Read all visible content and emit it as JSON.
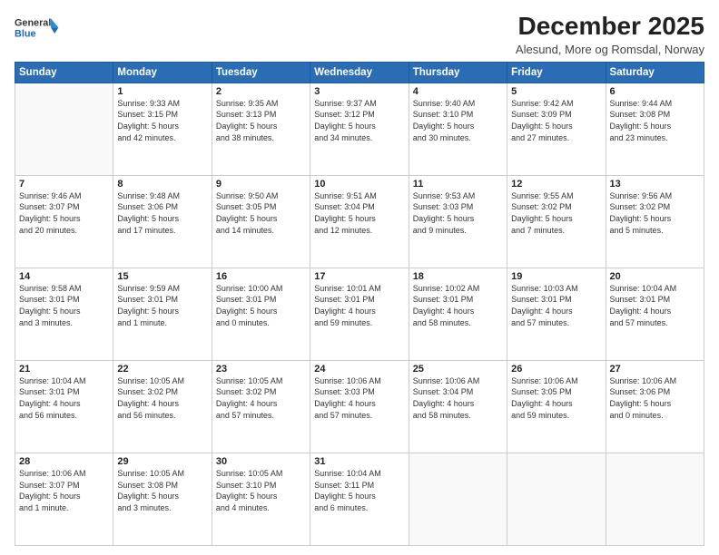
{
  "header": {
    "logo_line1": "General",
    "logo_line2": "Blue",
    "main_title": "December 2025",
    "subtitle": "Alesund, More og Romsdal, Norway"
  },
  "weekdays": [
    "Sunday",
    "Monday",
    "Tuesday",
    "Wednesday",
    "Thursday",
    "Friday",
    "Saturday"
  ],
  "weeks": [
    [
      {
        "day": "",
        "info": ""
      },
      {
        "day": "1",
        "info": "Sunrise: 9:33 AM\nSunset: 3:15 PM\nDaylight: 5 hours\nand 42 minutes."
      },
      {
        "day": "2",
        "info": "Sunrise: 9:35 AM\nSunset: 3:13 PM\nDaylight: 5 hours\nand 38 minutes."
      },
      {
        "day": "3",
        "info": "Sunrise: 9:37 AM\nSunset: 3:12 PM\nDaylight: 5 hours\nand 34 minutes."
      },
      {
        "day": "4",
        "info": "Sunrise: 9:40 AM\nSunset: 3:10 PM\nDaylight: 5 hours\nand 30 minutes."
      },
      {
        "day": "5",
        "info": "Sunrise: 9:42 AM\nSunset: 3:09 PM\nDaylight: 5 hours\nand 27 minutes."
      },
      {
        "day": "6",
        "info": "Sunrise: 9:44 AM\nSunset: 3:08 PM\nDaylight: 5 hours\nand 23 minutes."
      }
    ],
    [
      {
        "day": "7",
        "info": "Sunrise: 9:46 AM\nSunset: 3:07 PM\nDaylight: 5 hours\nand 20 minutes."
      },
      {
        "day": "8",
        "info": "Sunrise: 9:48 AM\nSunset: 3:06 PM\nDaylight: 5 hours\nand 17 minutes."
      },
      {
        "day": "9",
        "info": "Sunrise: 9:50 AM\nSunset: 3:05 PM\nDaylight: 5 hours\nand 14 minutes."
      },
      {
        "day": "10",
        "info": "Sunrise: 9:51 AM\nSunset: 3:04 PM\nDaylight: 5 hours\nand 12 minutes."
      },
      {
        "day": "11",
        "info": "Sunrise: 9:53 AM\nSunset: 3:03 PM\nDaylight: 5 hours\nand 9 minutes."
      },
      {
        "day": "12",
        "info": "Sunrise: 9:55 AM\nSunset: 3:02 PM\nDaylight: 5 hours\nand 7 minutes."
      },
      {
        "day": "13",
        "info": "Sunrise: 9:56 AM\nSunset: 3:02 PM\nDaylight: 5 hours\nand 5 minutes."
      }
    ],
    [
      {
        "day": "14",
        "info": "Sunrise: 9:58 AM\nSunset: 3:01 PM\nDaylight: 5 hours\nand 3 minutes."
      },
      {
        "day": "15",
        "info": "Sunrise: 9:59 AM\nSunset: 3:01 PM\nDaylight: 5 hours\nand 1 minute."
      },
      {
        "day": "16",
        "info": "Sunrise: 10:00 AM\nSunset: 3:01 PM\nDaylight: 5 hours\nand 0 minutes."
      },
      {
        "day": "17",
        "info": "Sunrise: 10:01 AM\nSunset: 3:01 PM\nDaylight: 4 hours\nand 59 minutes."
      },
      {
        "day": "18",
        "info": "Sunrise: 10:02 AM\nSunset: 3:01 PM\nDaylight: 4 hours\nand 58 minutes."
      },
      {
        "day": "19",
        "info": "Sunrise: 10:03 AM\nSunset: 3:01 PM\nDaylight: 4 hours\nand 57 minutes."
      },
      {
        "day": "20",
        "info": "Sunrise: 10:04 AM\nSunset: 3:01 PM\nDaylight: 4 hours\nand 57 minutes."
      }
    ],
    [
      {
        "day": "21",
        "info": "Sunrise: 10:04 AM\nSunset: 3:01 PM\nDaylight: 4 hours\nand 56 minutes."
      },
      {
        "day": "22",
        "info": "Sunrise: 10:05 AM\nSunset: 3:02 PM\nDaylight: 4 hours\nand 56 minutes."
      },
      {
        "day": "23",
        "info": "Sunrise: 10:05 AM\nSunset: 3:02 PM\nDaylight: 4 hours\nand 57 minutes."
      },
      {
        "day": "24",
        "info": "Sunrise: 10:06 AM\nSunset: 3:03 PM\nDaylight: 4 hours\nand 57 minutes."
      },
      {
        "day": "25",
        "info": "Sunrise: 10:06 AM\nSunset: 3:04 PM\nDaylight: 4 hours\nand 58 minutes."
      },
      {
        "day": "26",
        "info": "Sunrise: 10:06 AM\nSunset: 3:05 PM\nDaylight: 4 hours\nand 59 minutes."
      },
      {
        "day": "27",
        "info": "Sunrise: 10:06 AM\nSunset: 3:06 PM\nDaylight: 5 hours\nand 0 minutes."
      }
    ],
    [
      {
        "day": "28",
        "info": "Sunrise: 10:06 AM\nSunset: 3:07 PM\nDaylight: 5 hours\nand 1 minute."
      },
      {
        "day": "29",
        "info": "Sunrise: 10:05 AM\nSunset: 3:08 PM\nDaylight: 5 hours\nand 3 minutes."
      },
      {
        "day": "30",
        "info": "Sunrise: 10:05 AM\nSunset: 3:10 PM\nDaylight: 5 hours\nand 4 minutes."
      },
      {
        "day": "31",
        "info": "Sunrise: 10:04 AM\nSunset: 3:11 PM\nDaylight: 5 hours\nand 6 minutes."
      },
      {
        "day": "",
        "info": ""
      },
      {
        "day": "",
        "info": ""
      },
      {
        "day": "",
        "info": ""
      }
    ]
  ]
}
